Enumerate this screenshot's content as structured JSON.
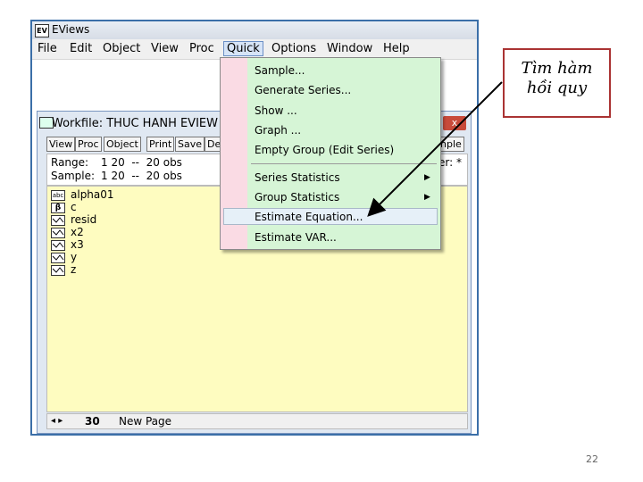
{
  "app": {
    "title": "EViews",
    "icon": "eviews-icon"
  },
  "menubar": {
    "items": [
      "File",
      "Edit",
      "Object",
      "View",
      "Proc",
      "Quick",
      "Options",
      "Window",
      "Help"
    ],
    "active": "Quick"
  },
  "quick_menu": {
    "items": [
      {
        "label": "Sample..."
      },
      {
        "label": "Generate Series..."
      },
      {
        "label": "Show ..."
      },
      {
        "label": "Graph ..."
      },
      {
        "label": "Empty Group (Edit Series)"
      },
      {
        "label": "Series Statistics",
        "submenu": true
      },
      {
        "label": "Group Statistics",
        "submenu": true
      },
      {
        "label": "Estimate Equation...",
        "highlighted": true
      },
      {
        "label": "Estimate VAR..."
      }
    ]
  },
  "workfile": {
    "title": "Workfile: THUC HANH EVIEW",
    "close_label": "x",
    "toolbar": [
      "View",
      "Proc",
      "Object",
      "Print",
      "Save",
      "De",
      "nple"
    ],
    "range_label": "Range:",
    "range_value": "1 20  --  20 obs",
    "sample_label": "Sample:",
    "sample_value": "1 20  --  20 obs",
    "filter": "er: *",
    "objects": [
      {
        "name": "alpha01",
        "icon": "abc-icon"
      },
      {
        "name": "c",
        "icon": "beta-icon"
      },
      {
        "name": "resid",
        "icon": "series-icon"
      },
      {
        "name": "x2",
        "icon": "series-icon"
      },
      {
        "name": "x3",
        "icon": "series-icon"
      },
      {
        "name": "y",
        "icon": "series-icon"
      },
      {
        "name": "z",
        "icon": "series-icon"
      }
    ],
    "tab_nav": "◂ ▸",
    "tab_active": "30",
    "tab_new": "New Page"
  },
  "callout": {
    "line1": "Tìm hàm",
    "line2": "hồi quy"
  },
  "page_number": "22",
  "colors": {
    "menu_bg": "#d6f5d6",
    "menu_gutter": "#fadbe4",
    "list_bg": "#fefcc0",
    "callout_border": "#aa3333"
  }
}
